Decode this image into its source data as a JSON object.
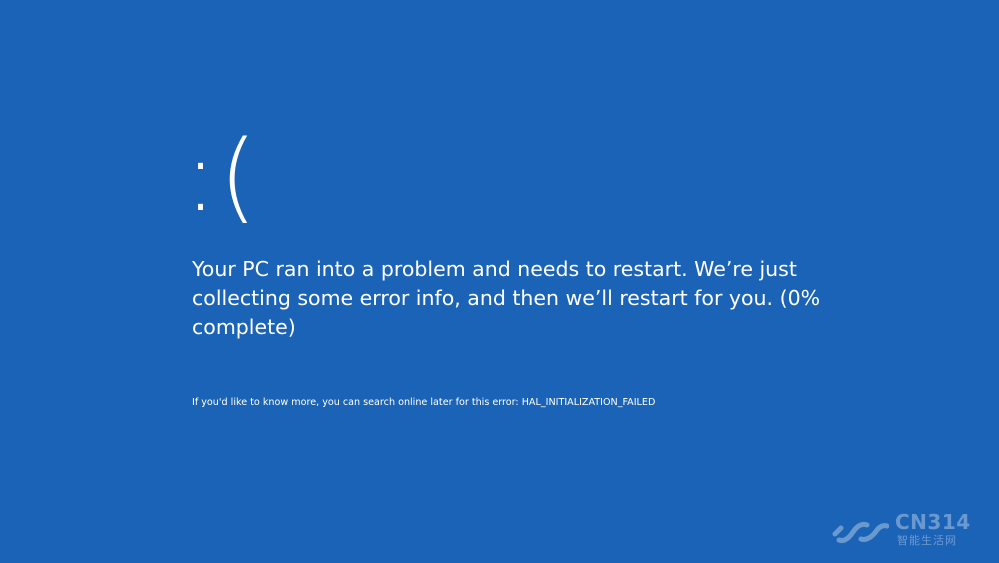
{
  "screen": {
    "background_color": "#1b63b7",
    "text_color": "#ffffff",
    "sad_face": ":(",
    "message": "Your PC ran into a problem and needs to restart. We’re just collecting some error info, and then we’ll restart for you. (0% complete)",
    "error_info": "If you'd like to know more, you can search online later for this error: HAL_INITIALIZATION_FAILED"
  },
  "watermark": {
    "logo_icon": "cn314-logo-icon",
    "brand": "CN314",
    "subtitle": "智能生活网"
  }
}
